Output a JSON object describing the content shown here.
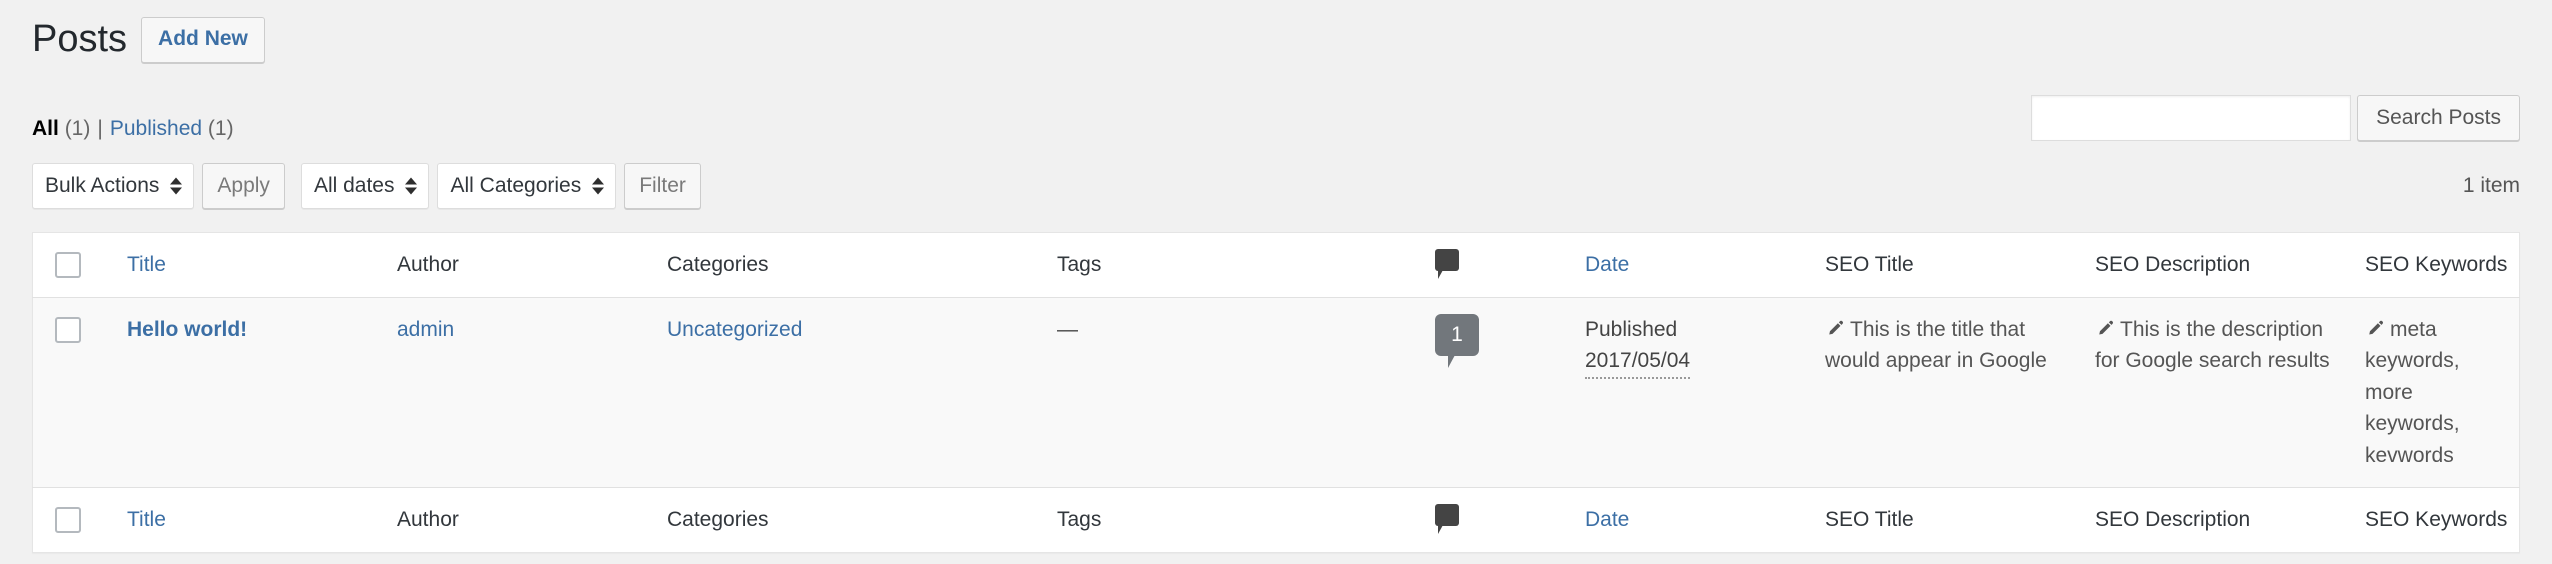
{
  "page": {
    "title": "Posts",
    "add_new_label": "Add New"
  },
  "status_links": {
    "all_label": "All",
    "all_count": "(1)",
    "separator": "|",
    "published_label": "Published",
    "published_count": "(1)"
  },
  "search": {
    "value": "",
    "placeholder": "",
    "submit_label": "Search Posts"
  },
  "tablenav": {
    "bulk_actions_label": "Bulk Actions",
    "apply_label": "Apply",
    "all_dates_label": "All dates",
    "all_categories_label": "All Categories",
    "filter_label": "Filter",
    "displaying_num": "1 item"
  },
  "table": {
    "columns": [
      {
        "key": "cb",
        "label": "",
        "icon": "checkbox-icon",
        "link": false
      },
      {
        "key": "title",
        "label": "Title",
        "link": true
      },
      {
        "key": "author",
        "label": "Author",
        "link": false
      },
      {
        "key": "categories",
        "label": "Categories",
        "link": false
      },
      {
        "key": "tags",
        "label": "Tags",
        "link": false
      },
      {
        "key": "comments",
        "label": "",
        "icon": "comment-bubble-icon",
        "link": false
      },
      {
        "key": "date",
        "label": "Date",
        "link": true
      },
      {
        "key": "seo_title",
        "label": "SEO Title",
        "link": false
      },
      {
        "key": "seo_description",
        "label": "SEO Description",
        "link": false
      },
      {
        "key": "seo_keywords",
        "label": "SEO Keywords",
        "link": false
      }
    ],
    "rows": [
      {
        "title": "Hello world!",
        "author": "admin",
        "categories": "Uncategorized",
        "tags": "—",
        "comment_count": "1",
        "date_status": "Published",
        "date_value": "2017/05/04",
        "seo_title": "This is the title that would appear in Google",
        "seo_description": "This is the description for Google search results",
        "seo_keywords": "meta keywords, more keywords, kevwords"
      }
    ]
  },
  "colors": {
    "page_background": "#f1f1f1",
    "link_blue": "#3c6fa5",
    "table_background": "#ffffff",
    "row_background": "#f9f9f9",
    "comment_badge": "#72777c",
    "border": "#e5e5e5"
  }
}
